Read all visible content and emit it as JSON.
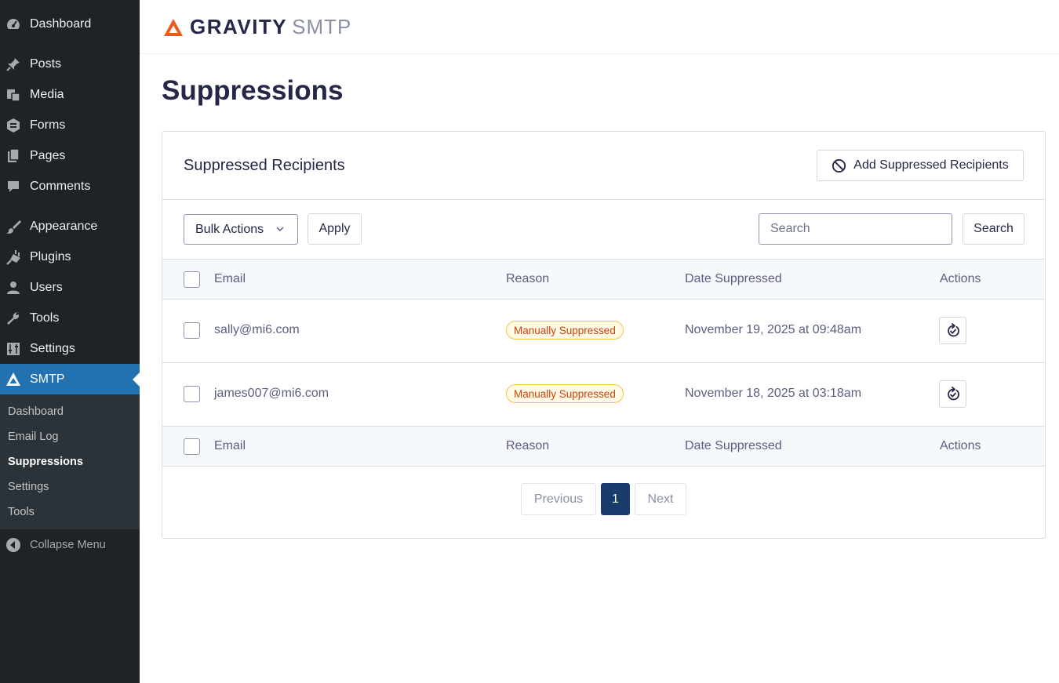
{
  "sidebar": {
    "items": [
      {
        "label": "Dashboard",
        "icon": "dashboard-icon"
      },
      {
        "label": "Posts",
        "icon": "pin-icon"
      },
      {
        "label": "Media",
        "icon": "media-icon"
      },
      {
        "label": "Forms",
        "icon": "forms-icon"
      },
      {
        "label": "Pages",
        "icon": "pages-icon"
      },
      {
        "label": "Comments",
        "icon": "comment-icon"
      },
      {
        "label": "Appearance",
        "icon": "brush-icon"
      },
      {
        "label": "Plugins",
        "icon": "plug-icon"
      },
      {
        "label": "Users",
        "icon": "user-icon"
      },
      {
        "label": "Tools",
        "icon": "wrench-icon"
      },
      {
        "label": "Settings",
        "icon": "sliders-icon"
      },
      {
        "label": "SMTP",
        "icon": "gravity-logo-icon"
      }
    ],
    "submenu": [
      "Dashboard",
      "Email Log",
      "Suppressions",
      "Settings",
      "Tools"
    ],
    "collapse_label": "Collapse Menu",
    "active_color": "#2271b1",
    "bg_color": "#1d2327"
  },
  "header": {
    "logo_primary": "GRAVITY",
    "logo_secondary": "SMTP",
    "logo_accent": "#ea5b1a"
  },
  "page": {
    "title": "Suppressions"
  },
  "card": {
    "title": "Suppressed Recipients",
    "add_button": "Add Suppressed Recipients",
    "bulk_actions": "Bulk Actions",
    "apply": "Apply",
    "search_placeholder": "Search",
    "search_button": "Search"
  },
  "table": {
    "columns": [
      "Email",
      "Reason",
      "Date Suppressed",
      "Actions"
    ],
    "rows": [
      {
        "email": "sally@mi6.com",
        "reason": "Manually Suppressed",
        "date": "November 19, 2025 at 09:48am"
      },
      {
        "email": "james007@mi6.com",
        "reason": "Manually Suppressed",
        "date": "November 18, 2025 at 03:18am"
      }
    ]
  },
  "pagination": {
    "previous": "Previous",
    "current": "1",
    "next": "Next"
  }
}
